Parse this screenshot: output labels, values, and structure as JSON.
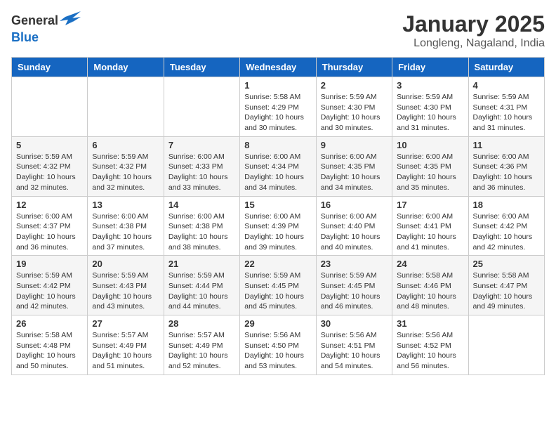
{
  "header": {
    "logo_general": "General",
    "logo_blue": "Blue",
    "month": "January 2025",
    "location": "Longleng, Nagaland, India"
  },
  "days_of_week": [
    "Sunday",
    "Monday",
    "Tuesday",
    "Wednesday",
    "Thursday",
    "Friday",
    "Saturday"
  ],
  "weeks": [
    [
      {
        "day": "",
        "info": ""
      },
      {
        "day": "",
        "info": ""
      },
      {
        "day": "",
        "info": ""
      },
      {
        "day": "1",
        "info": "Sunrise: 5:58 AM\nSunset: 4:29 PM\nDaylight: 10 hours\nand 30 minutes."
      },
      {
        "day": "2",
        "info": "Sunrise: 5:59 AM\nSunset: 4:30 PM\nDaylight: 10 hours\nand 30 minutes."
      },
      {
        "day": "3",
        "info": "Sunrise: 5:59 AM\nSunset: 4:30 PM\nDaylight: 10 hours\nand 31 minutes."
      },
      {
        "day": "4",
        "info": "Sunrise: 5:59 AM\nSunset: 4:31 PM\nDaylight: 10 hours\nand 31 minutes."
      }
    ],
    [
      {
        "day": "5",
        "info": "Sunrise: 5:59 AM\nSunset: 4:32 PM\nDaylight: 10 hours\nand 32 minutes."
      },
      {
        "day": "6",
        "info": "Sunrise: 5:59 AM\nSunset: 4:32 PM\nDaylight: 10 hours\nand 32 minutes."
      },
      {
        "day": "7",
        "info": "Sunrise: 6:00 AM\nSunset: 4:33 PM\nDaylight: 10 hours\nand 33 minutes."
      },
      {
        "day": "8",
        "info": "Sunrise: 6:00 AM\nSunset: 4:34 PM\nDaylight: 10 hours\nand 34 minutes."
      },
      {
        "day": "9",
        "info": "Sunrise: 6:00 AM\nSunset: 4:35 PM\nDaylight: 10 hours\nand 34 minutes."
      },
      {
        "day": "10",
        "info": "Sunrise: 6:00 AM\nSunset: 4:35 PM\nDaylight: 10 hours\nand 35 minutes."
      },
      {
        "day": "11",
        "info": "Sunrise: 6:00 AM\nSunset: 4:36 PM\nDaylight: 10 hours\nand 36 minutes."
      }
    ],
    [
      {
        "day": "12",
        "info": "Sunrise: 6:00 AM\nSunset: 4:37 PM\nDaylight: 10 hours\nand 36 minutes."
      },
      {
        "day": "13",
        "info": "Sunrise: 6:00 AM\nSunset: 4:38 PM\nDaylight: 10 hours\nand 37 minutes."
      },
      {
        "day": "14",
        "info": "Sunrise: 6:00 AM\nSunset: 4:38 PM\nDaylight: 10 hours\nand 38 minutes."
      },
      {
        "day": "15",
        "info": "Sunrise: 6:00 AM\nSunset: 4:39 PM\nDaylight: 10 hours\nand 39 minutes."
      },
      {
        "day": "16",
        "info": "Sunrise: 6:00 AM\nSunset: 4:40 PM\nDaylight: 10 hours\nand 40 minutes."
      },
      {
        "day": "17",
        "info": "Sunrise: 6:00 AM\nSunset: 4:41 PM\nDaylight: 10 hours\nand 41 minutes."
      },
      {
        "day": "18",
        "info": "Sunrise: 6:00 AM\nSunset: 4:42 PM\nDaylight: 10 hours\nand 42 minutes."
      }
    ],
    [
      {
        "day": "19",
        "info": "Sunrise: 5:59 AM\nSunset: 4:42 PM\nDaylight: 10 hours\nand 42 minutes."
      },
      {
        "day": "20",
        "info": "Sunrise: 5:59 AM\nSunset: 4:43 PM\nDaylight: 10 hours\nand 43 minutes."
      },
      {
        "day": "21",
        "info": "Sunrise: 5:59 AM\nSunset: 4:44 PM\nDaylight: 10 hours\nand 44 minutes."
      },
      {
        "day": "22",
        "info": "Sunrise: 5:59 AM\nSunset: 4:45 PM\nDaylight: 10 hours\nand 45 minutes."
      },
      {
        "day": "23",
        "info": "Sunrise: 5:59 AM\nSunset: 4:45 PM\nDaylight: 10 hours\nand 46 minutes."
      },
      {
        "day": "24",
        "info": "Sunrise: 5:58 AM\nSunset: 4:46 PM\nDaylight: 10 hours\nand 48 minutes."
      },
      {
        "day": "25",
        "info": "Sunrise: 5:58 AM\nSunset: 4:47 PM\nDaylight: 10 hours\nand 49 minutes."
      }
    ],
    [
      {
        "day": "26",
        "info": "Sunrise: 5:58 AM\nSunset: 4:48 PM\nDaylight: 10 hours\nand 50 minutes."
      },
      {
        "day": "27",
        "info": "Sunrise: 5:57 AM\nSunset: 4:49 PM\nDaylight: 10 hours\nand 51 minutes."
      },
      {
        "day": "28",
        "info": "Sunrise: 5:57 AM\nSunset: 4:49 PM\nDaylight: 10 hours\nand 52 minutes."
      },
      {
        "day": "29",
        "info": "Sunrise: 5:56 AM\nSunset: 4:50 PM\nDaylight: 10 hours\nand 53 minutes."
      },
      {
        "day": "30",
        "info": "Sunrise: 5:56 AM\nSunset: 4:51 PM\nDaylight: 10 hours\nand 54 minutes."
      },
      {
        "day": "31",
        "info": "Sunrise: 5:56 AM\nSunset: 4:52 PM\nDaylight: 10 hours\nand 56 minutes."
      },
      {
        "day": "",
        "info": ""
      }
    ]
  ]
}
